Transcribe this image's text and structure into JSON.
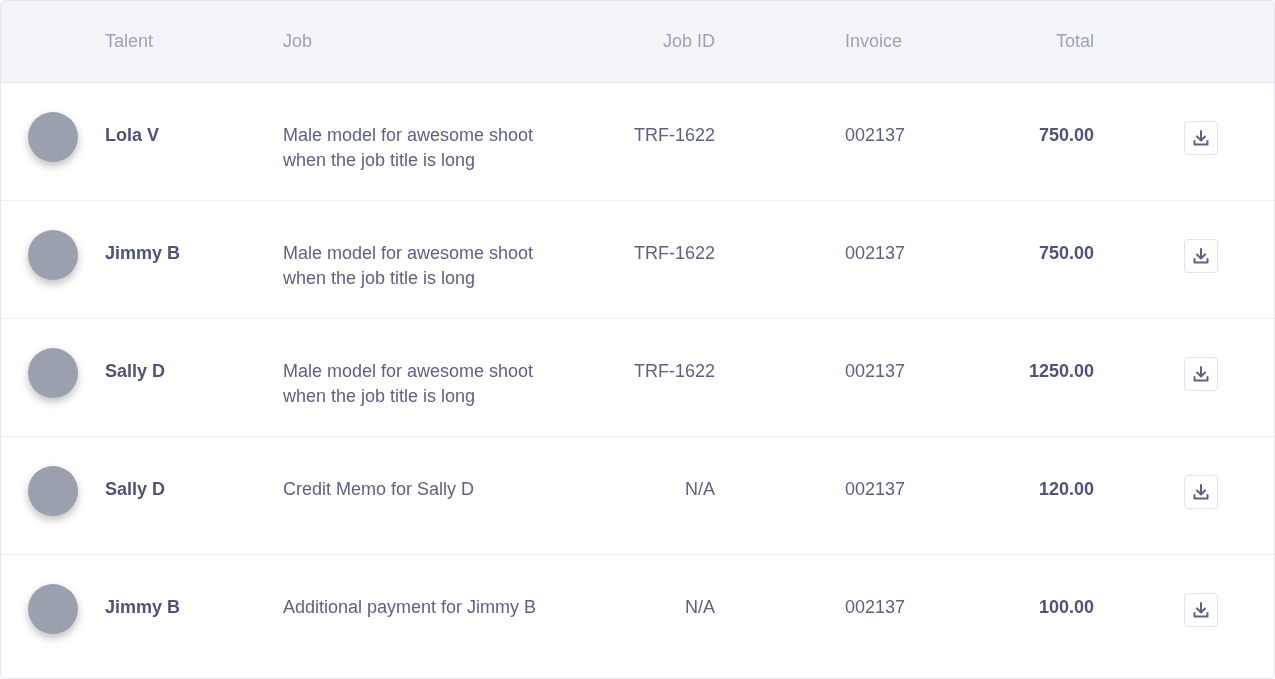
{
  "table": {
    "columns": [
      "Talent",
      "Job",
      "Job ID",
      "Invoice",
      "Total"
    ],
    "rows": [
      {
        "talent": "Lola V",
        "job": "Male model for awesome shoot when the job title is long",
        "job_id": "TRF-1622",
        "invoice": "002137",
        "total": "750.00"
      },
      {
        "talent": "Jimmy B",
        "job": "Male model for awesome shoot when the job title is long",
        "job_id": "TRF-1622",
        "invoice": "002137",
        "total": "750.00"
      },
      {
        "talent": "Sally D",
        "job": "Male model for awesome shoot when the job title is long",
        "job_id": "TRF-1622",
        "invoice": "002137",
        "total": "1250.00"
      },
      {
        "talent": "Sally D",
        "job": "Credit Memo for Sally D",
        "job_id": "N/A",
        "invoice": "002137",
        "total": "120.00"
      },
      {
        "talent": "Jimmy B",
        "job": "Additional payment for Jimmy B",
        "job_id": "N/A",
        "invoice": "002137",
        "total": "100.00"
      }
    ]
  }
}
